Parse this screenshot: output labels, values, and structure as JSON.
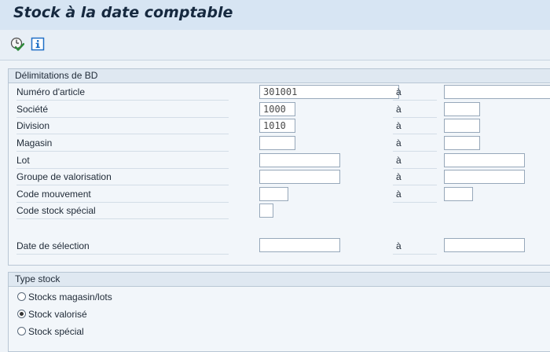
{
  "title": "Stock à la date comptable",
  "toolbar": {
    "execute_icon": "execute-clock-icon",
    "info_icon": "info-icon"
  },
  "bd": {
    "header": "Délimitations de BD",
    "to_label": "à",
    "fields": [
      {
        "label": "Numéro d'article",
        "from": "301001",
        "to": ""
      },
      {
        "label": "Société",
        "from": "1000",
        "to": ""
      },
      {
        "label": "Division",
        "from": "1010",
        "to": ""
      },
      {
        "label": "Magasin",
        "from": "",
        "to": ""
      },
      {
        "label": "Lot",
        "from": "",
        "to": ""
      },
      {
        "label": "Groupe de valorisation",
        "from": "",
        "to": ""
      },
      {
        "label": "Code mouvement",
        "from": "",
        "to": ""
      },
      {
        "label": "Code stock spécial",
        "from": ""
      },
      {
        "label": "Date de sélection",
        "from": "",
        "to": ""
      }
    ]
  },
  "stock_type": {
    "header": "Type stock",
    "options": [
      {
        "label": "Stocks magasin/lots",
        "selected": false
      },
      {
        "label": "Stock valorisé",
        "selected": true
      },
      {
        "label": "Stock spécial",
        "selected": false
      }
    ]
  },
  "colors": {
    "title_bg": "#d7e5f3",
    "execute_green": "#2e8b3a",
    "info_blue": "#1f6fc6"
  }
}
